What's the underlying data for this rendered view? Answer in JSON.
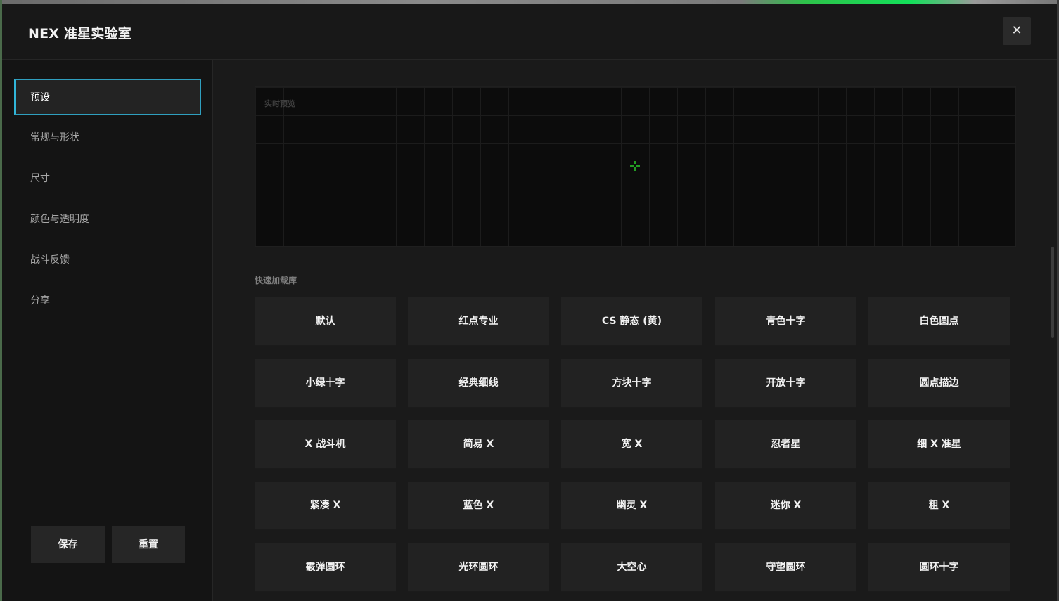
{
  "dialog": {
    "title": "NEX 准星实验室",
    "close_symbol": "✕"
  },
  "sidebar": {
    "items": [
      {
        "label": "预设",
        "active": true
      },
      {
        "label": "常规与形状",
        "active": false
      },
      {
        "label": "尺寸",
        "active": false
      },
      {
        "label": "颜色与透明度",
        "active": false
      },
      {
        "label": "战斗反馈",
        "active": false
      },
      {
        "label": "分享",
        "active": false
      }
    ],
    "save_label": "保存",
    "reset_label": "重置"
  },
  "preview": {
    "label": "实时预览",
    "crosshair_color": "#2bdc2b"
  },
  "library": {
    "label": "快速加载库",
    "presets": [
      "默认",
      "红点专业",
      "CS 静态 (黄)",
      "青色十字",
      "白色圆点",
      "小绿十字",
      "经典细线",
      "方块十字",
      "开放十字",
      "圆点描边",
      "X 战斗机",
      "简易 X",
      "宽 X",
      "忍者星",
      "细 X 准星",
      "紧凑 X",
      "蓝色 X",
      "幽灵 X",
      "迷你 X",
      "粗 X",
      "霰弹圆环",
      "光环圆环",
      "大空心",
      "守望圆环",
      "圆环十字"
    ]
  },
  "colors": {
    "accent": "#31b5d8",
    "background": "#1a1a1a",
    "button": "#222222"
  }
}
